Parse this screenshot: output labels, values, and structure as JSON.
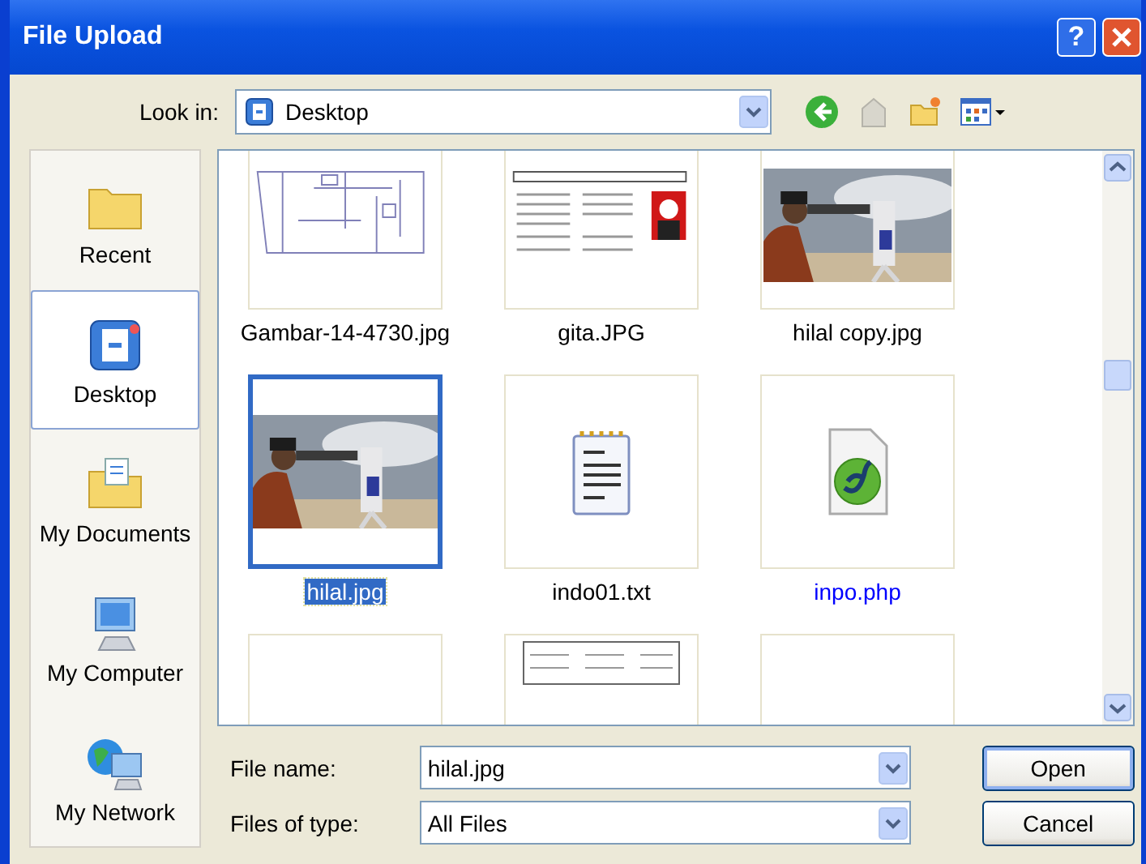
{
  "window": {
    "title": "File Upload",
    "help_label": "?"
  },
  "look_in": {
    "label": "Look in:",
    "value": "Desktop"
  },
  "places": [
    {
      "label": "Recent",
      "kind": "recent",
      "selected": false
    },
    {
      "label": "Desktop",
      "kind": "desktop",
      "selected": true
    },
    {
      "label": "My Documents",
      "kind": "documents",
      "selected": false
    },
    {
      "label": "My Computer",
      "kind": "computer",
      "selected": false
    },
    {
      "label": "My Network",
      "kind": "network",
      "selected": false
    }
  ],
  "files": [
    {
      "name": "Gambar-14-4730.jpg",
      "kind": "schematic",
      "selected": false
    },
    {
      "name": "gita.JPG",
      "kind": "document",
      "selected": false
    },
    {
      "name": "hilal copy.jpg",
      "kind": "photo-banner",
      "selected": false
    },
    {
      "name": "hilal.jpg",
      "selected": true
    },
    {
      "name": "indo01.txt",
      "kind": "text",
      "selected": false
    },
    {
      "name": "inpo.php",
      "kind": "php",
      "selected": false,
      "color": "#0000ff"
    },
    {
      "kind": "blank",
      "selected": false
    },
    {
      "kind": "table",
      "selected": false
    },
    {
      "kind": "blank",
      "selected": false
    }
  ],
  "file_name": {
    "label": "File name:",
    "value": "hilal.jpg"
  },
  "file_type": {
    "label": "Files of type:",
    "value": "All Files"
  },
  "buttons": [
    {
      "label": "Open",
      "default": true
    },
    {
      "label": "Cancel",
      "default": false
    }
  ]
}
